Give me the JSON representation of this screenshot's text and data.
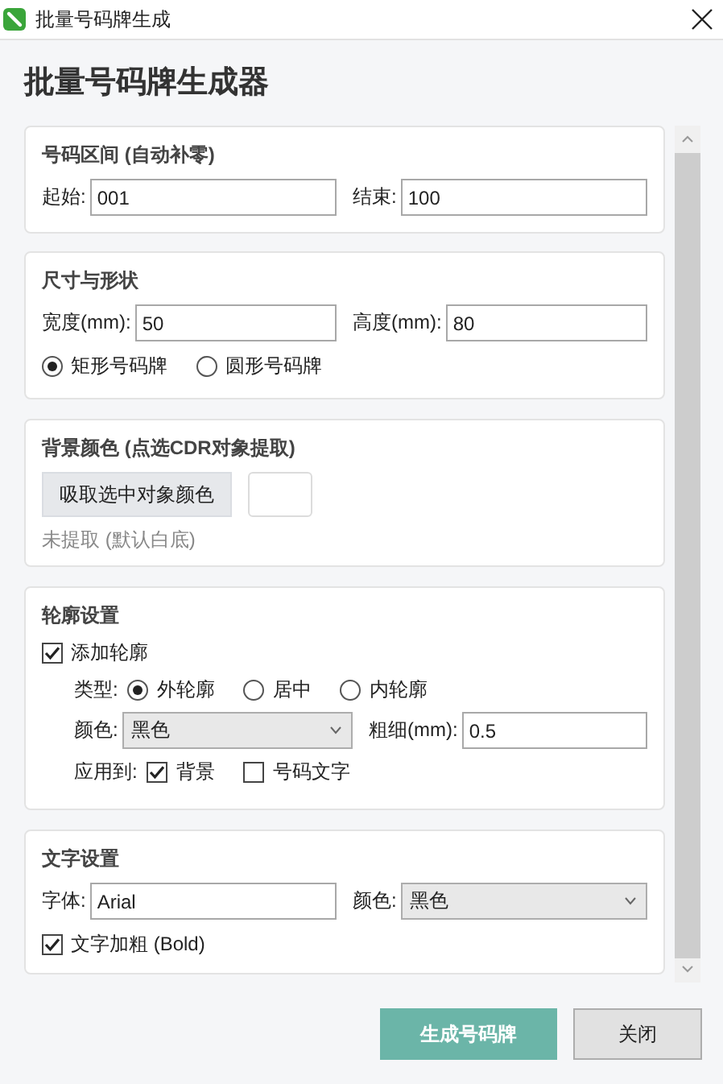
{
  "window": {
    "title": "批量号码牌生成"
  },
  "heading": "批量号码牌生成器",
  "range": {
    "title": "号码区间 (自动补零)",
    "start": {
      "label": "起始:",
      "value": "001"
    },
    "end": {
      "label": "结束:",
      "value": "100"
    }
  },
  "size": {
    "title": "尺寸与形状",
    "width": {
      "label": "宽度(mm):",
      "value": "50"
    },
    "height": {
      "label": "高度(mm):",
      "value": "80"
    },
    "shapes": [
      {
        "label": "矩形号码牌",
        "selected": true
      },
      {
        "label": "圆形号码牌",
        "selected": false
      }
    ]
  },
  "background": {
    "title": "背景颜色 (点选CDR对象提取)",
    "pick_button": "吸取选中对象颜色",
    "status": "未提取 (默认白底)"
  },
  "outline": {
    "title": "轮廓设置",
    "enable": {
      "label": "添加轮廓",
      "checked": true
    },
    "type": {
      "label": "类型:",
      "options": [
        {
          "label": "外轮廓",
          "selected": true
        },
        {
          "label": "居中",
          "selected": false
        },
        {
          "label": "内轮廓",
          "selected": false
        }
      ]
    },
    "color": {
      "label": "颜色:",
      "value": "黑色"
    },
    "thickness": {
      "label": "粗细(mm):",
      "value": "0.5"
    },
    "apply_to": {
      "label": "应用到:",
      "options": [
        {
          "label": "背景",
          "checked": true
        },
        {
          "label": "号码文字",
          "checked": false
        }
      ]
    }
  },
  "text": {
    "title": "文字设置",
    "font": {
      "label": "字体:",
      "value": "Arial"
    },
    "color": {
      "label": "颜色:",
      "value": "黑色"
    },
    "bold": {
      "label": "文字加粗 (Bold)",
      "checked": true
    }
  },
  "buttons": [
    {
      "label": "生成号码牌",
      "kind": "primary"
    },
    {
      "label": "关闭",
      "kind": "secondary"
    }
  ]
}
